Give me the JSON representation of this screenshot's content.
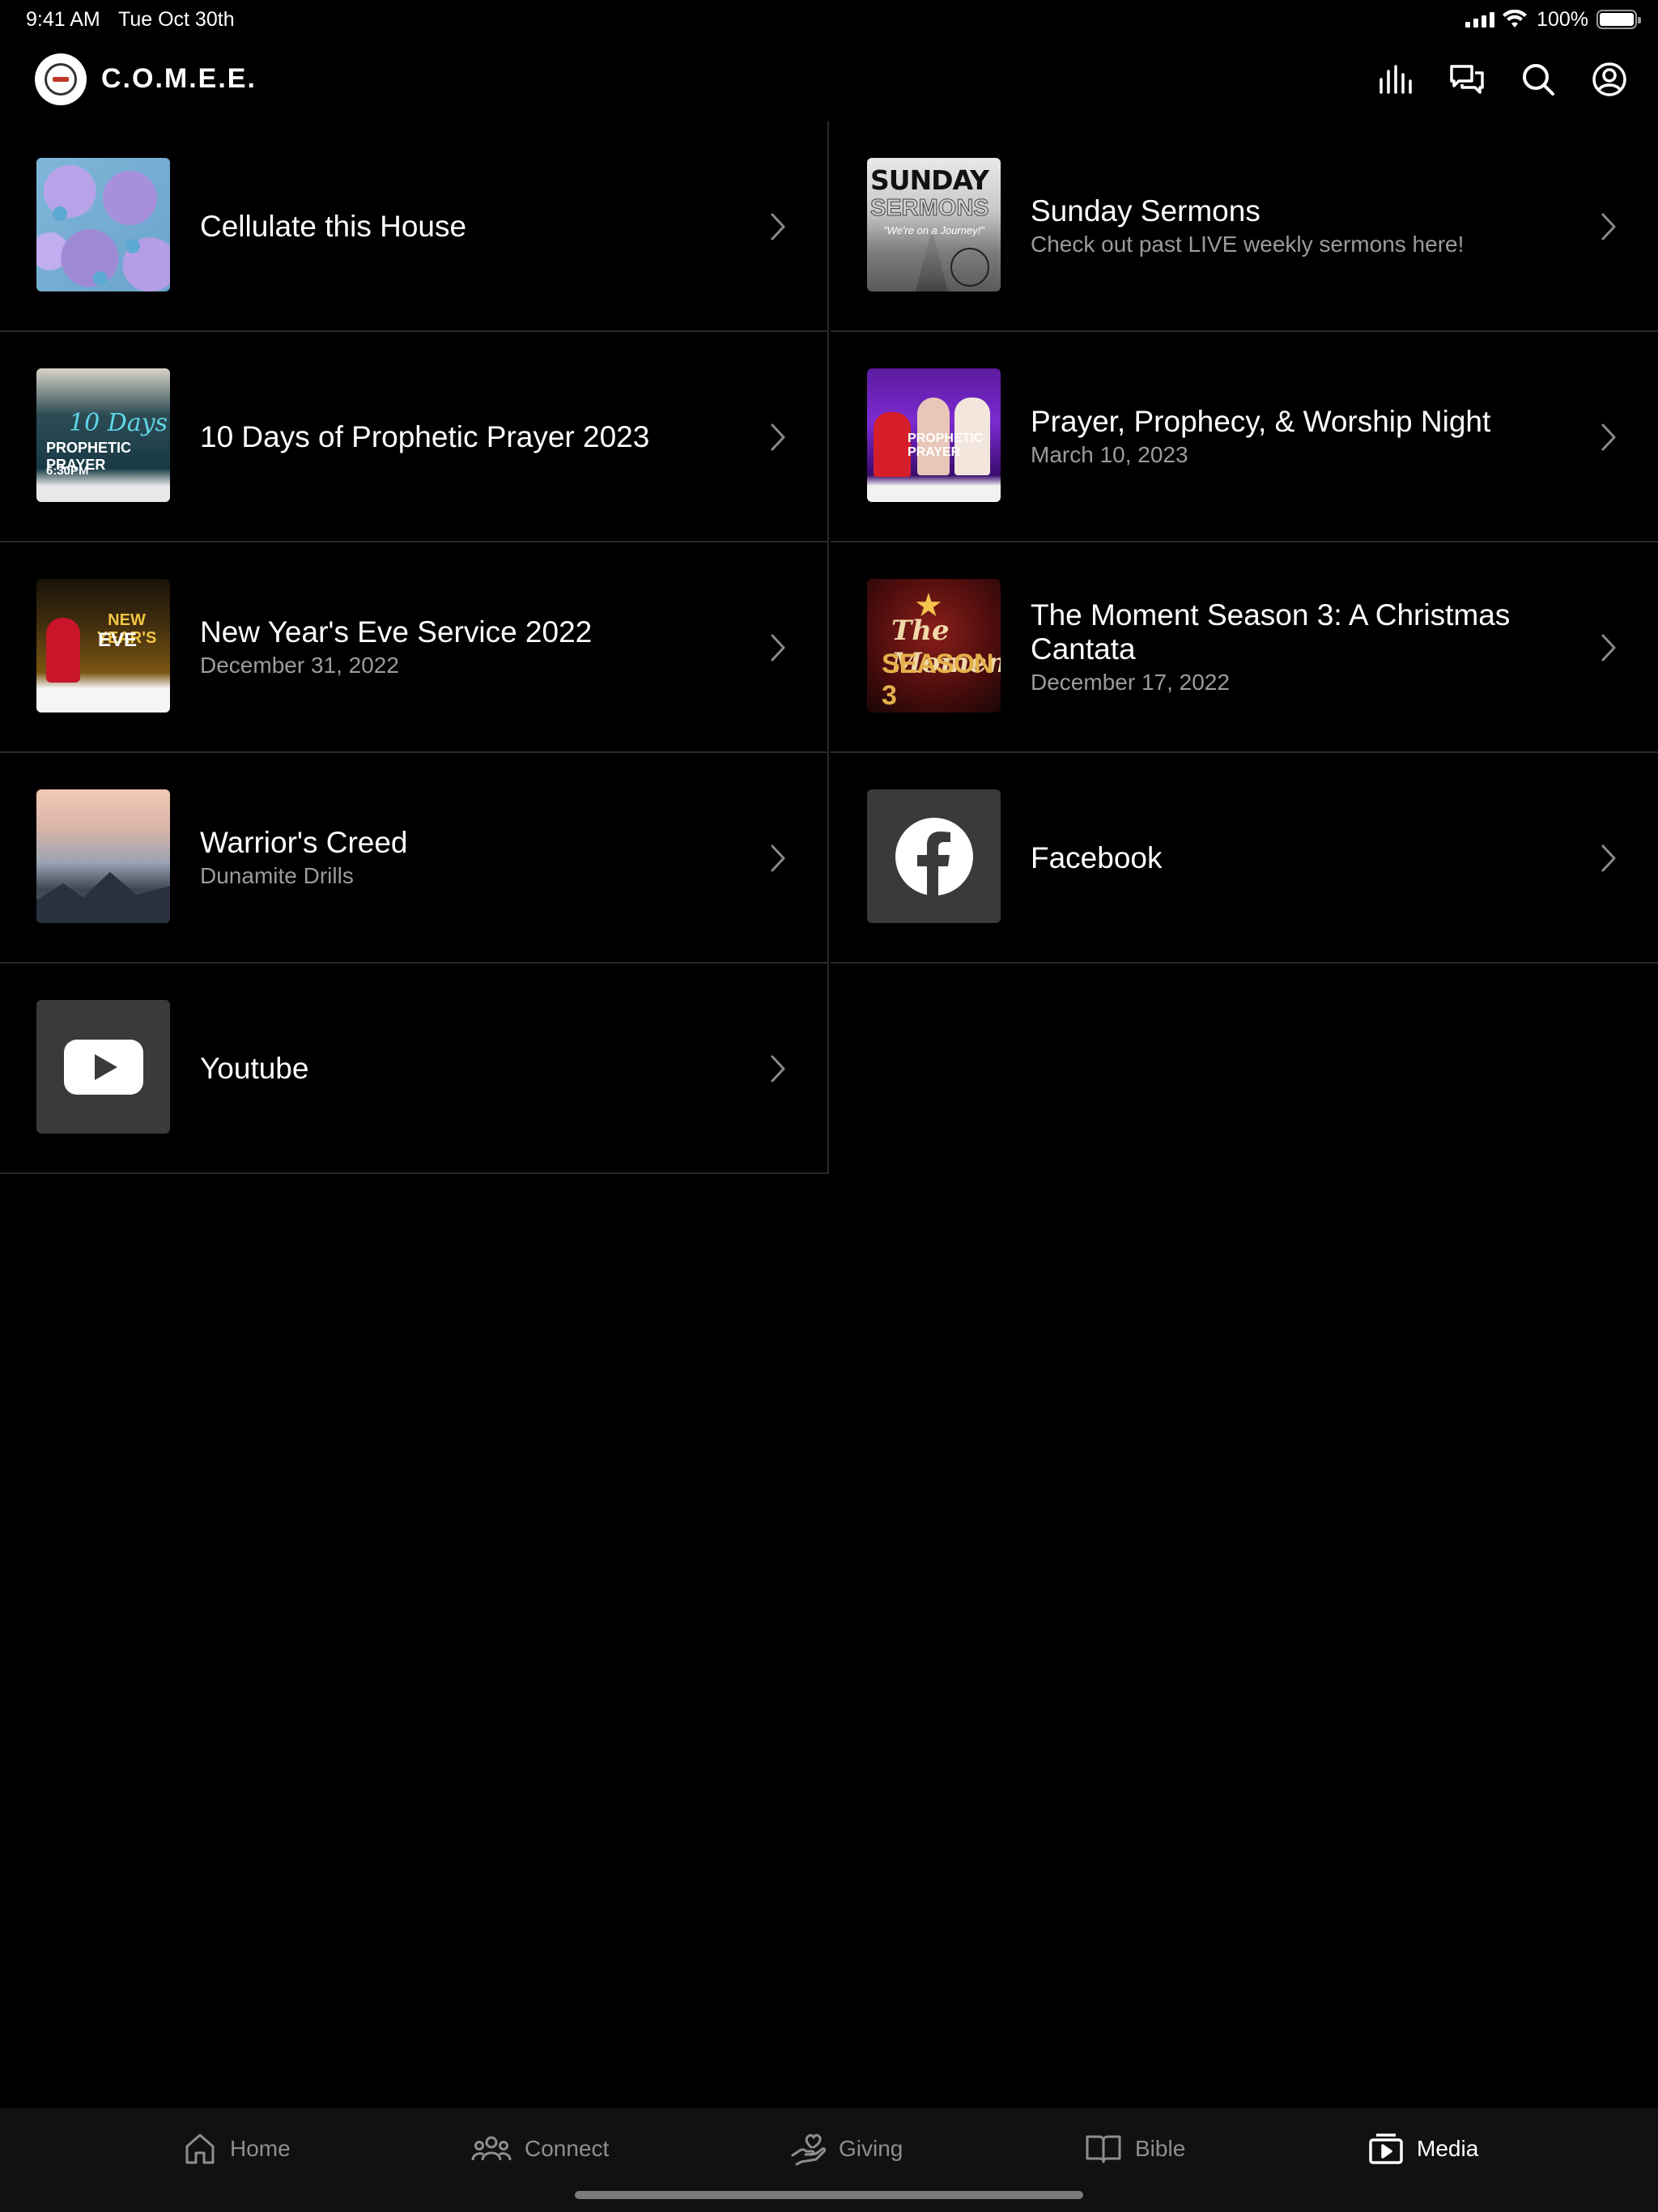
{
  "status_bar": {
    "time": "9:41 AM",
    "date": "Tue Oct 30th",
    "battery": "100%"
  },
  "header": {
    "title": "C.O.M.E.E.",
    "icons": [
      "audio-bars-icon",
      "chat-icon",
      "search-icon",
      "profile-icon"
    ]
  },
  "items": [
    {
      "title": "Cellulate this House",
      "subtitle": "",
      "thumbnail": "cells-image"
    },
    {
      "title": "Sunday Sermons",
      "subtitle": "Check out past LIVE weekly sermons here!",
      "thumbnail": "sunday-sermons-image",
      "thumb_text": {
        "line1": "SUNDAY",
        "line2": "SERMONS",
        "line3": "\"We're on a Journey!\""
      }
    },
    {
      "title": "10 Days of Prophetic Prayer 2023",
      "subtitle": "",
      "thumbnail": "ten-days-flyer",
      "thumb_text": {
        "line1": "10 Days",
        "line2": "PROPHETIC PRAYER",
        "line3": "6:30PM"
      }
    },
    {
      "title": "Prayer, Prophecy, & Worship Night",
      "subtitle": "March 10, 2023",
      "thumbnail": "prophecy-flyer",
      "thumb_text": {
        "line1": "PROPHETIC PRAYER"
      }
    },
    {
      "title": "New Year's Eve Service 2022",
      "subtitle": "December 31, 2022",
      "thumbnail": "new-years-eve-flyer",
      "thumb_text": {
        "line1": "NEW YEAR'S",
        "line2": "EVE"
      }
    },
    {
      "title": "The Moment Season 3: A Christmas Cantata",
      "subtitle": "December 17, 2022",
      "thumbnail": "the-moment-flyer",
      "thumb_text": {
        "line1": "The Moment",
        "line2": "SEASON 3"
      }
    },
    {
      "title": "Warrior's Creed",
      "subtitle": "Dunamite Drills",
      "thumbnail": "mountain-clouds-image"
    },
    {
      "title": "Facebook",
      "subtitle": "",
      "thumbnail": "facebook-icon"
    },
    {
      "title": "Youtube",
      "subtitle": "",
      "thumbnail": "youtube-icon"
    }
  ],
  "tabs": [
    {
      "label": "Home",
      "icon": "home-icon",
      "active": false
    },
    {
      "label": "Connect",
      "icon": "people-icon",
      "active": false
    },
    {
      "label": "Giving",
      "icon": "giving-hand-icon",
      "active": false
    },
    {
      "label": "Bible",
      "icon": "book-icon",
      "active": false
    },
    {
      "label": "Media",
      "icon": "media-play-icon",
      "active": true
    }
  ],
  "colors": {
    "background": "#000000",
    "divider": "#2a2a2a",
    "subtitle": "#9b9b9b",
    "tab_bar": "#111111",
    "tab_inactive": "#8e8e8e",
    "tab_active": "#ffffff"
  }
}
